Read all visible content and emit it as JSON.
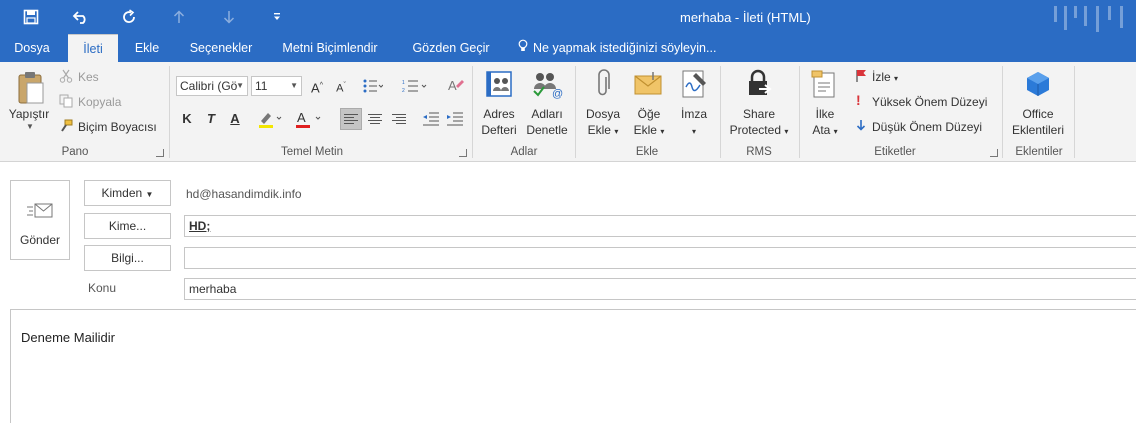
{
  "window": {
    "title": "merhaba  -  İleti (HTML)",
    "accent_color": "#2b6cc4"
  },
  "quick_access": {
    "icons": [
      "save-icon",
      "undo-icon",
      "redo-icon",
      "up-arrow-icon",
      "down-arrow-icon",
      "customize-icon"
    ]
  },
  "tabs": [
    {
      "label": "Dosya"
    },
    {
      "label": "İleti"
    },
    {
      "label": "Ekle"
    },
    {
      "label": "Seçenekler"
    },
    {
      "label": "Metni Biçimlendir"
    },
    {
      "label": "Gözden Geçir"
    }
  ],
  "tell_me": "Ne yapmak istediğinizi söyleyin...",
  "ribbon": {
    "pano": {
      "label": "Pano",
      "paste": "Yapıştır",
      "cut": "Kes",
      "copy": "Kopyala",
      "format_painter": "Biçim Boyacısı"
    },
    "basic_text": {
      "label": "Temel Metin",
      "font": "Calibri (Gö",
      "size": "11",
      "bold": "K",
      "italic": "T",
      "underline": "A"
    },
    "names": {
      "label": "Adlar",
      "address_book": [
        "Adres",
        "Defteri"
      ],
      "check_names": [
        "Adları",
        "Denetle"
      ]
    },
    "include": {
      "label": "Ekle",
      "attach_file": [
        "Dosya",
        "Ekle"
      ],
      "attach_item": [
        "Öğe",
        "Ekle"
      ],
      "signature": "İmza"
    },
    "rms": {
      "label": "RMS",
      "share_protected": [
        "Share",
        "Protected"
      ]
    },
    "tags": {
      "label": "Etiketler",
      "assign_policy": [
        "İlke",
        "Ata"
      ],
      "follow_up": "İzle",
      "high_importance": "Yüksek Önem Düzeyi",
      "low_importance": "Düşük Önem Düzeyi"
    },
    "addins": {
      "label": "Eklentiler",
      "office_addins": [
        "Office",
        "Eklentileri"
      ]
    }
  },
  "compose": {
    "send": "Gönder",
    "from_button": "Kimden",
    "from_value": "hd@hasandimdik.info",
    "to_button": "Kime...",
    "to_value": "HD;",
    "cc_button": "Bilgi...",
    "cc_value": "",
    "subject_label": "Konu",
    "subject_value": "merhaba",
    "body": "Deneme Mailidir"
  }
}
